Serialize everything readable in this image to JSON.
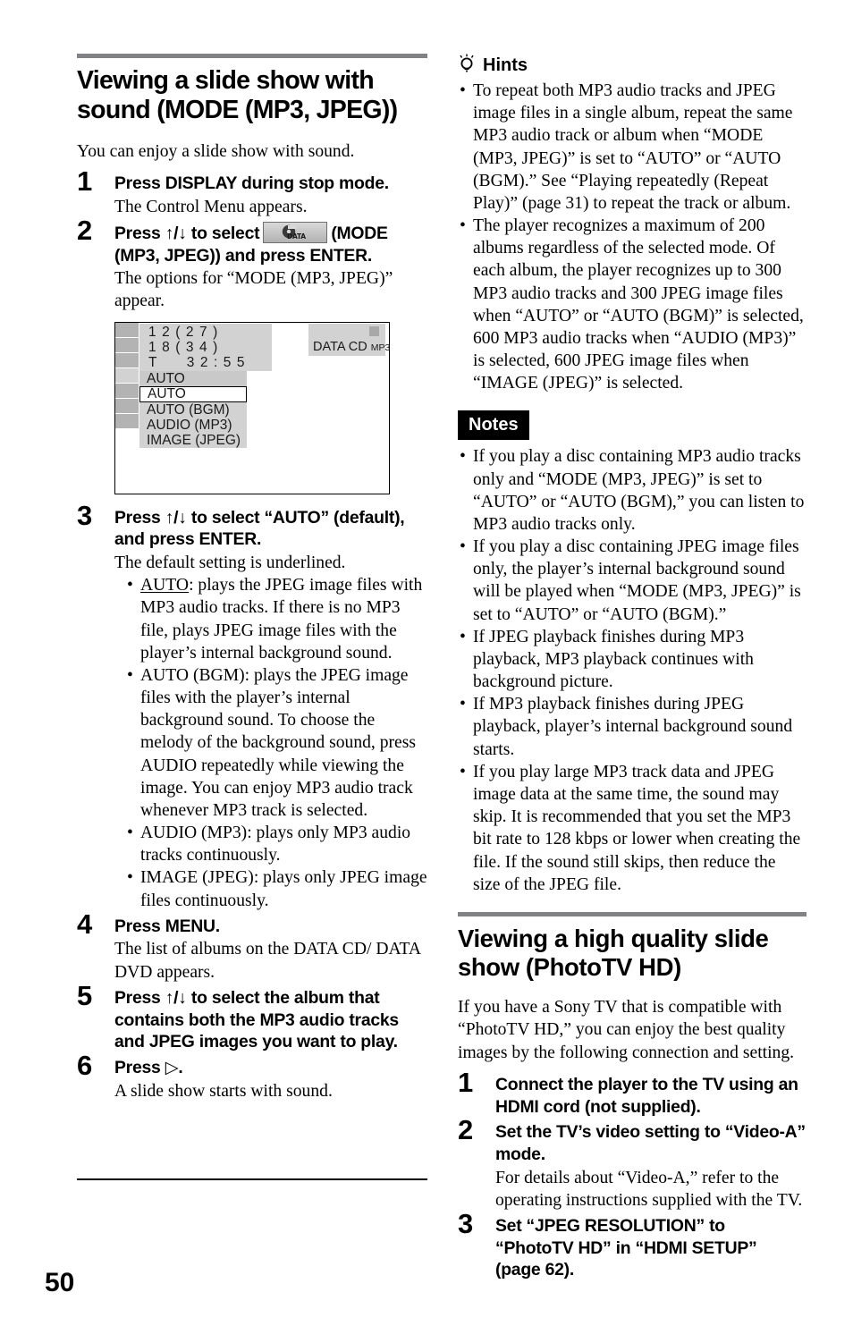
{
  "page": {
    "folio": "50"
  },
  "left": {
    "heading": "Viewing a slide show with sound (MODE (MP3, JPEG))",
    "intro": "You can enjoy a slide show with sound.",
    "steps": [
      {
        "num": "1",
        "headline": "Press DISPLAY during stop mode.",
        "sub": "The Control Menu appears."
      },
      {
        "num": "2",
        "headline_pre": "Press ↑/↓ to select",
        "headline_post": "(MODE (MP3, JPEG)) and press ENTER.",
        "icon_label": "DATA",
        "sub": "The options for “MODE (MP3, JPEG)” appear."
      },
      {
        "num": "3",
        "headline": "Press ↑/↓ to select “AUTO” (default), and press ENTER.",
        "sub": "The default setting is underlined.",
        "bullets": [
          {
            "lead": "AUTO",
            "underline": true,
            "text": ": plays the JPEG image files with MP3 audio tracks. If there is no MP3 file, plays JPEG image files with the player’s internal background sound."
          },
          {
            "lead": "AUTO (BGM)",
            "underline": false,
            "text": ": plays the JPEG image files with the player’s internal background sound. To choose the melody of the background sound, press AUDIO repeatedly while viewing the image. You can enjoy MP3 audio track whenever MP3 track is selected."
          },
          {
            "lead": "AUDIO (MP3)",
            "underline": false,
            "text": ": plays only MP3 audio tracks continuously."
          },
          {
            "lead": "IMAGE (JPEG)",
            "underline": false,
            "text": ": plays only JPEG image files continuously."
          }
        ]
      },
      {
        "num": "4",
        "headline": "Press MENU.",
        "sub": "The list of albums on the DATA CD/ DATA DVD appears."
      },
      {
        "num": "5",
        "headline": "Press ↑/↓ to select the album that contains both the MP3 audio tracks and JPEG images you want to play."
      },
      {
        "num": "6",
        "headline": "Press ▷.",
        "sub": "A slide show starts with sound."
      }
    ],
    "screen": {
      "info_rows": [
        "1 2 ( 2 7 )",
        "1 8 ( 3 4 )",
        "T      3 2 : 5 5"
      ],
      "current_value": "AUTO",
      "options": [
        "AUTO",
        "AUTO (BGM)",
        "AUDIO (MP3)",
        "IMAGE (JPEG)"
      ],
      "selected_option": "AUTO",
      "disc_label": "DATA CD",
      "disc_format": "MP3",
      "icon_count": 7
    }
  },
  "right": {
    "hints": {
      "title": "Hints",
      "icon": "lightbulb-icon",
      "items": [
        "To repeat both MP3 audio tracks and JPEG image files in a single album, repeat the same MP3 audio track or album when “MODE (MP3, JPEG)” is set to “AUTO” or “AUTO (BGM).” See “Playing repeatedly (Repeat Play)” (page 31) to repeat the track or album.",
        "The player recognizes a maximum of 200 albums regardless of the selected mode. Of each album, the player recognizes up to 300 MP3 audio tracks and 300 JPEG image files when “AUTO” or “AUTO (BGM)” is selected, 600 MP3 audio tracks when “AUDIO (MP3)” is selected, 600 JPEG image files when “IMAGE (JPEG)” is selected."
      ]
    },
    "notes": {
      "title": "Notes",
      "items": [
        "If you play a disc containing MP3 audio tracks only and “MODE (MP3, JPEG)” is set to “AUTO” or “AUTO (BGM),” you can listen to MP3 audio tracks only.",
        "If you play a disc containing JPEG image files only, the player’s internal background sound will be played when “MODE (MP3, JPEG)” is set to “AUTO” or “AUTO (BGM).”",
        "If JPEG playback finishes during MP3 playback, MP3 playback continues with background picture.",
        "If MP3 playback finishes during JPEG playback, player’s internal background sound starts.",
        "If you play large MP3 track data and JPEG image data at the same time, the sound may skip. It is recommended that you set the MP3 bit rate to 128 kbps or lower when creating the file. If the sound still skips, then reduce the size of the JPEG file."
      ]
    },
    "heading": "Viewing a high quality slide show (PhotoTV HD)",
    "intro": "If you have a Sony TV that is compatible with “PhotoTV HD,” you can enjoy the best quality images by the following connection and setting.",
    "steps": [
      {
        "num": "1",
        "headline": "Connect the player to the TV using an HDMI cord (not supplied)."
      },
      {
        "num": "2",
        "headline": "Set the TV’s video setting to “Video-A” mode.",
        "sub": "For details about “Video-A,” refer to the operating instructions supplied with the TV."
      },
      {
        "num": "3",
        "headline": "Set “JPEG RESOLUTION” to “PhotoTV HD” in “HDMI SETUP” (page 62)."
      }
    ]
  }
}
